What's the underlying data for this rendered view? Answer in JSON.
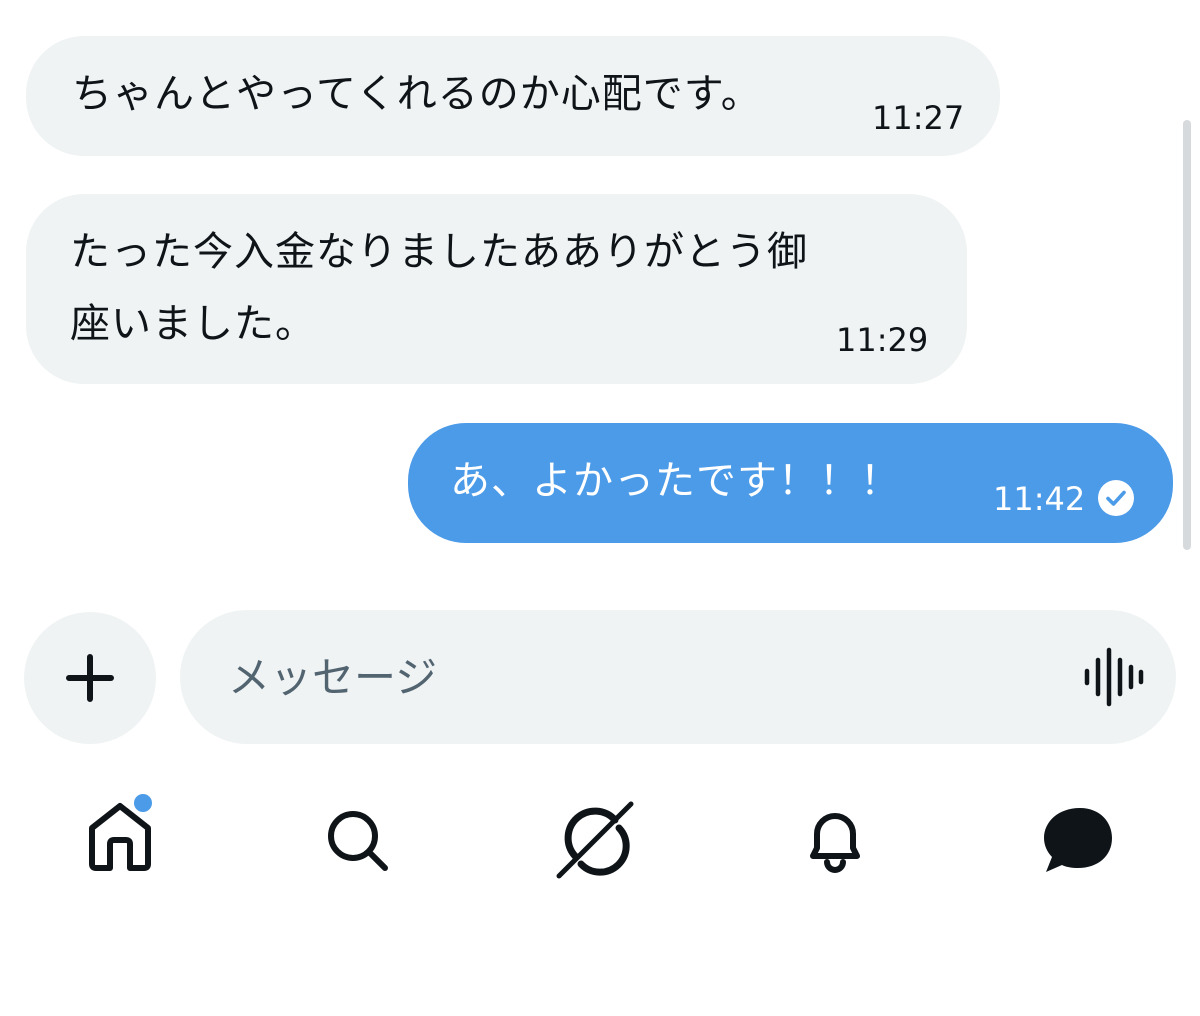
{
  "messages": [
    {
      "direction": "received",
      "text": "ちゃんとやってくれるのか心配です。",
      "time": "11:27"
    },
    {
      "direction": "received",
      "lines": [
        "たった今入金なりましたあありがとう御",
        "座いました。"
      ],
      "time": "11:29"
    },
    {
      "direction": "sent",
      "text": "あ、よかったです！！！",
      "time": "11:42",
      "status_icon": "check-circle-icon"
    }
  ],
  "composer": {
    "add_icon": "plus-icon",
    "placeholder": "メッセージ",
    "value": "",
    "voice_icon": "voice-waveform-icon"
  },
  "nav": {
    "items": [
      {
        "name": "home",
        "icon": "home-icon",
        "has_notification_dot": true
      },
      {
        "name": "search",
        "icon": "search-icon"
      },
      {
        "name": "grok",
        "icon": "grok-icon"
      },
      {
        "name": "notifications",
        "icon": "bell-icon"
      },
      {
        "name": "messages",
        "icon": "message-bubble-icon",
        "active": true
      }
    ]
  },
  "colors": {
    "accent": "#4c9be8",
    "incoming_bubble": "#eff3f4",
    "text": "#0f1419",
    "placeholder": "#536471"
  }
}
